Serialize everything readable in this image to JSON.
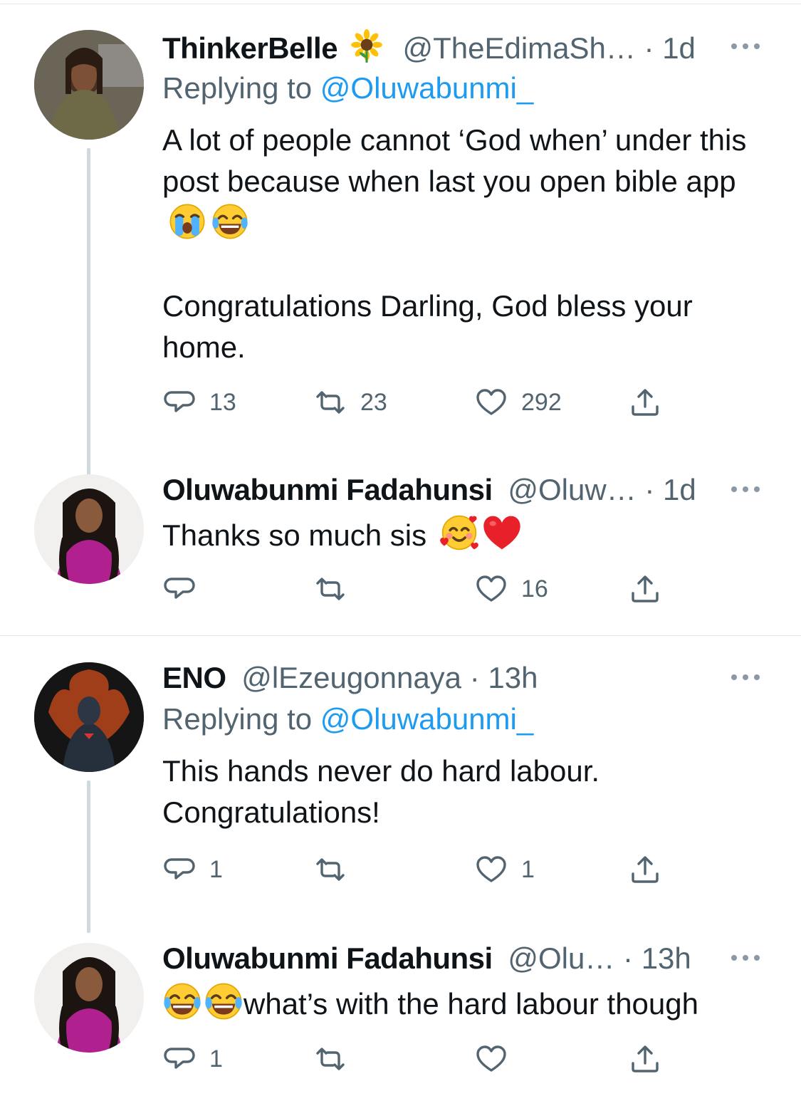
{
  "tweets": [
    {
      "name": "ThinkerBelle",
      "name_emoji": "sunflower",
      "handle": "@TheEdimaSh…",
      "time": "1d",
      "replying_prefix": "Replying to ",
      "replying_to": "@Oluwabunmi_",
      "text_1": "A lot of people cannot ‘God when’ under this post because when last you open bible app",
      "text_2": "Congratulations Darling, God bless your home.",
      "emojis": [
        "loudly-crying-face",
        "face-with-tears-of-joy"
      ],
      "replies": "13",
      "retweets": "23",
      "likes": "292"
    },
    {
      "name": "Oluwabunmi Fadahunsi",
      "handle": "@Oluw…",
      "time": "1d",
      "text": "Thanks so much sis",
      "emojis": [
        "smiling-face-with-hearts",
        "red-heart"
      ],
      "replies": "",
      "retweets": "",
      "likes": "16"
    },
    {
      "name": "ENO",
      "handle": "@lEzeugonnaya",
      "time": "13h",
      "replying_prefix": "Replying to ",
      "replying_to": "@Oluwabunmi_",
      "text": "This hands never do hard labour.\nCongratulations!",
      "replies": "1",
      "retweets": "",
      "likes": "1"
    },
    {
      "name": "Oluwabunmi Fadahunsi",
      "handle": "@Olu…",
      "time": "13h",
      "emojis": [
        "face-with-tears-of-joy",
        "face-with-tears-of-joy"
      ],
      "text": "what’s with the hard labour though",
      "replies": "1",
      "retweets": "",
      "likes": ""
    }
  ],
  "separator": "·",
  "colors": {
    "link": "#1d9bf0",
    "secondary": "#536471",
    "divider": "#e1e8ed",
    "thread": "#cfd9de",
    "heart": "#e8202a"
  }
}
